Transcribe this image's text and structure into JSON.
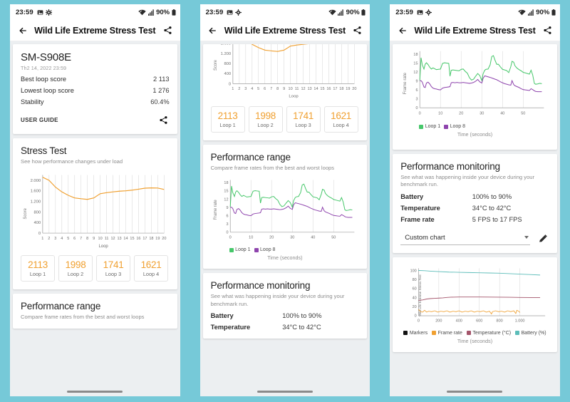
{
  "background_color": "#76c9d8",
  "statusbar": {
    "time": "23:59",
    "battery_percent": "90%",
    "icons": [
      "gallery-icon",
      "gear-icon",
      "wifi-icon",
      "signal-icon",
      "battery-icon"
    ]
  },
  "appbar": {
    "title": "Wild Life Extreme Stress Test",
    "back_icon": "back-arrow-icon",
    "share_icon": "share-icon"
  },
  "panel1": {
    "device_name": "SM-S908E",
    "device_date": "Th2 14, 2022 23:59",
    "rows": [
      {
        "label": "Best loop score",
        "value": "2 113"
      },
      {
        "label": "Lowest loop score",
        "value": "1 276"
      },
      {
        "label": "Stability",
        "value": "60.4%"
      }
    ],
    "user_guide_label": "USER GUIDE",
    "stress_test": {
      "title": "Stress Test",
      "subtitle": "See how performance changes under load"
    },
    "performance_range": {
      "title": "Performance range",
      "subtitle": "Compare frame rates from the best and worst loops"
    }
  },
  "panel2": {
    "performance_range": {
      "title": "Performance range",
      "subtitle": "Compare frame rates from the best and worst loops"
    },
    "performance_monitoring": {
      "title": "Performance monitoring",
      "subtitle": "See what was happening inside your device during your benchmark run.",
      "rows": [
        {
          "label": "Battery",
          "value": "100% to 90%"
        },
        {
          "label": "Temperature",
          "value": "34°C to 42°C"
        }
      ]
    }
  },
  "panel3": {
    "performance_monitoring": {
      "title": "Performance monitoring",
      "subtitle": "See what was happening inside your device during your benchmark run.",
      "rows": [
        {
          "label": "Battery",
          "value": "100% to 90%"
        },
        {
          "label": "Temperature",
          "value": "34°C to 42°C"
        },
        {
          "label": "Frame rate",
          "value": "5 FPS to 17 FPS"
        }
      ],
      "select_value": "Custom chart",
      "edit_icon": "pencil-icon",
      "dropdown_icon": "chevron-down-icon"
    }
  },
  "loop_scores": [
    {
      "score": "2113",
      "label": "Loop 1"
    },
    {
      "score": "1998",
      "label": "Loop 2"
    },
    {
      "score": "1741",
      "label": "Loop 3"
    },
    {
      "score": "1621",
      "label": "Loop 4"
    }
  ],
  "colors": {
    "accent_orange": "#f0a030",
    "loop1_green": "#46c76a",
    "loop8_purple": "#8e44ad",
    "battery_teal": "#5cbdb9",
    "temperature_maroon": "#a4546a",
    "markers_black": "#111111",
    "background_teal": "#76c9d8"
  },
  "chart_data": [
    {
      "id": "stress-test-chart",
      "type": "line",
      "title": "Stress Test",
      "xlabel": "Loop",
      "ylabel": "Score",
      "xlim": [
        1,
        20
      ],
      "ylim": [
        0,
        2200
      ],
      "yticks": [
        "0",
        "400",
        "800",
        "1.200",
        "1.600",
        "2.000"
      ],
      "xticks": [
        "1",
        "2",
        "3",
        "4",
        "5",
        "6",
        "7",
        "8",
        "9",
        "10",
        "11",
        "12",
        "13",
        "14",
        "15",
        "16",
        "17",
        "18",
        "19",
        "20"
      ],
      "grid": true,
      "series": [
        {
          "name": "Score",
          "color": "#f0a030",
          "x": [
            1,
            2,
            3,
            4,
            5,
            6,
            7,
            8,
            9,
            10,
            11,
            12,
            13,
            14,
            15,
            16,
            17,
            18,
            19,
            20
          ],
          "values": [
            2113,
            1998,
            1741,
            1560,
            1430,
            1330,
            1300,
            1276,
            1330,
            1490,
            1530,
            1560,
            1585,
            1600,
            1625,
            1660,
            1700,
            1710,
            1705,
            1650
          ]
        }
      ]
    },
    {
      "id": "performance-range-chart",
      "type": "line",
      "title": "Performance range",
      "xlabel": "Time (seconds)",
      "ylabel": "Frame rate",
      "xlim": [
        0,
        60
      ],
      "ylim": [
        0,
        19
      ],
      "yticks": [
        "0",
        "3",
        "6",
        "9",
        "12",
        "15",
        "18"
      ],
      "xticks": [
        "0",
        "10",
        "20",
        "30",
        "40",
        "50"
      ],
      "grid": true,
      "legend_position": "bottom-left",
      "series": [
        {
          "name": "Loop 1",
          "color": "#46c76a",
          "x": [
            0,
            0.6,
            1.2,
            2,
            2.6,
            3.2,
            4,
            4.8,
            5.6,
            6.4,
            7.2,
            8,
            9,
            10,
            11,
            12,
            13,
            14,
            14.6,
            15.2,
            16,
            17,
            18,
            19,
            20,
            21,
            22,
            23,
            24,
            25,
            26,
            27,
            28,
            29,
            30,
            30.6,
            31.4,
            32,
            33,
            34,
            34.8,
            35.6,
            36.4,
            37.2,
            38,
            39,
            40,
            41,
            42,
            43,
            44,
            44.6,
            45.4,
            46,
            47,
            48,
            49,
            50,
            51,
            52,
            53,
            53.8,
            54.6,
            55.4,
            56,
            57,
            58,
            59
          ],
          "values": [
            9.2,
            16.8,
            14.4,
            13.0,
            14.6,
            15.1,
            14.5,
            13.6,
            13.0,
            13.4,
            13.1,
            12.8,
            12.9,
            13.0,
            14.9,
            15.1,
            15.0,
            14.9,
            10.6,
            12.6,
            12.7,
            12.6,
            12.5,
            12.4,
            12.9,
            13.0,
            12.2,
            11.6,
            10.1,
            9.3,
            9.6,
            10.6,
            11.5,
            10.8,
            9.1,
            11.4,
            12.6,
            12.9,
            13.0,
            14.4,
            17.2,
            17.5,
            15.9,
            14.6,
            14.6,
            13.7,
            12.9,
            12.7,
            12.5,
            11.8,
            13.8,
            15.6,
            15.3,
            14.1,
            13.3,
            12.8,
            12.4,
            11.9,
            11.7,
            11.5,
            11.3,
            12.6,
            11.0,
            8.2,
            7.9,
            8.0,
            8.2,
            8.1
          ]
        },
        {
          "name": "Loop 8",
          "color": "#8e44ad",
          "x": [
            0,
            0.6,
            1.2,
            2,
            2.6,
            3.2,
            4,
            4.8,
            5.6,
            6.4,
            7.2,
            8,
            9,
            10,
            11,
            12,
            13,
            14,
            14.6,
            15.2,
            16,
            17,
            18,
            19,
            20,
            21,
            22,
            23,
            24,
            25,
            26,
            27,
            28,
            29,
            30,
            30.6,
            31.4,
            32,
            33,
            34,
            34.8,
            35.6,
            36.4,
            37.2,
            38,
            39,
            40,
            41,
            42,
            43,
            44,
            44.6,
            45.4,
            46,
            47,
            48,
            49,
            50,
            51,
            52,
            53,
            53.8,
            54.6,
            55.4,
            56,
            57,
            58,
            59
          ],
          "values": [
            9.0,
            9.1,
            8.6,
            7.0,
            6.8,
            8.3,
            8.6,
            8.0,
            7.1,
            6.6,
            6.4,
            6.3,
            6.1,
            6.0,
            6.6,
            6.8,
            6.9,
            7.0,
            7.1,
            8.4,
            8.5,
            8.4,
            8.5,
            8.4,
            8.4,
            8.5,
            8.4,
            8.3,
            8.2,
            8.3,
            8.5,
            8.9,
            9.5,
            8.7,
            8.3,
            9.9,
            10.7,
            10.6,
            10.4,
            10.2,
            10.0,
            9.8,
            9.6,
            9.4,
            9.1,
            8.7,
            8.4,
            8.1,
            7.9,
            7.7,
            7.6,
            9.1,
            7.8,
            7.4,
            7.1,
            6.8,
            6.4,
            6.1,
            6.0,
            5.9,
            5.8,
            6.4,
            6.1,
            5.7,
            5.5,
            5.4,
            5.4,
            5.4
          ]
        }
      ]
    },
    {
      "id": "custom-chart",
      "type": "line",
      "title": "Custom chart",
      "xlabel": "Time (seconds)",
      "ylabel": "Wild Life Extreme Stress Test",
      "xlim": [
        0,
        1250
      ],
      "ylim": [
        0,
        105
      ],
      "yticks": [
        "0",
        "20",
        "40",
        "60",
        "80",
        "100"
      ],
      "xticks": [
        "0",
        "200",
        "400",
        "600",
        "800",
        "1.000"
      ],
      "grid": true,
      "legend_position": "bottom",
      "series": [
        {
          "name": "Markers",
          "color": "#111111",
          "x": [],
          "values": []
        },
        {
          "name": "Frame rate",
          "color": "#f0a030",
          "x": [
            0,
            20,
            40,
            60,
            80,
            100,
            130,
            160,
            190,
            220,
            250,
            280,
            310,
            340,
            370,
            400,
            430,
            460,
            490,
            520,
            550,
            580,
            610,
            640,
            670,
            700,
            720,
            730,
            760,
            790,
            820,
            850,
            880,
            910,
            940,
            960,
            970,
            990,
            1000
          ],
          "values": [
            14,
            9,
            8,
            12,
            8,
            10,
            9,
            11,
            8,
            10,
            9,
            11,
            8,
            10,
            9,
            11,
            8,
            10,
            9,
            11,
            8,
            10,
            9,
            11,
            8,
            10,
            4,
            9,
            11,
            9,
            10,
            8,
            11,
            9,
            11,
            5,
            12,
            10,
            7
          ]
        },
        {
          "name": "Temperature (°C)",
          "color": "#a4546a",
          "x": [
            0,
            40,
            80,
            120,
            160,
            200,
            240,
            280,
            320,
            400,
            500,
            600,
            700,
            800,
            900,
            1000,
            1100,
            1200
          ],
          "values": [
            34,
            35,
            37,
            38,
            38.5,
            39,
            39.5,
            40.5,
            41,
            41.5,
            41.5,
            41.5,
            41.3,
            41,
            40.8,
            40.5,
            40.3,
            40
          ]
        },
        {
          "name": "Battery (%)",
          "color": "#5cbdb9",
          "x": [
            0,
            60,
            120,
            200,
            300,
            400,
            500,
            600,
            700,
            800,
            900,
            1000,
            1100,
            1200
          ],
          "values": [
            100,
            99.5,
            98.5,
            97.5,
            96.5,
            96,
            95.5,
            95,
            94.5,
            94,
            93,
            92,
            91,
            90
          ]
        }
      ]
    }
  ]
}
